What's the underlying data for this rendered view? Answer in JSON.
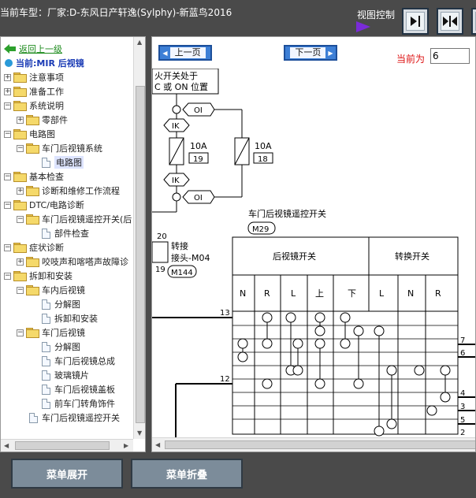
{
  "header": {
    "car_model": "当前车型：厂家:D-东风日产轩逸(Sylphy)-新蓝鸟2016",
    "view_control_label": "视图控制"
  },
  "tree": {
    "back_label": "返回上一级",
    "current_label": "当前:MIR 后视镜",
    "items": [
      {
        "label": "注意事项"
      },
      {
        "label": "准备工作"
      },
      {
        "label": "系统说明"
      },
      {
        "label": "零部件"
      },
      {
        "label": "电路图"
      },
      {
        "label": "车门后视镜系统"
      },
      {
        "label": "电路图"
      },
      {
        "label": "基本检查"
      },
      {
        "label": "诊断和维修工作流程"
      },
      {
        "label": "DTC/电路诊断"
      },
      {
        "label": "车门后视镜遥控开关(后"
      },
      {
        "label": "部件检查"
      },
      {
        "label": "症状诊断"
      },
      {
        "label": "咬吱声和喀嗒声故障诊"
      },
      {
        "label": "拆卸和安装"
      },
      {
        "label": "车内后视镜"
      },
      {
        "label": "分解图"
      },
      {
        "label": "拆卸和安装"
      },
      {
        "label": "车门后视镜"
      },
      {
        "label": "分解图"
      },
      {
        "label": "车门后视镜总成"
      },
      {
        "label": "玻璃镜片"
      },
      {
        "label": "车门后视镜盖板"
      },
      {
        "label": "前车门转角饰件"
      },
      {
        "label": "车门后视镜遥控开关"
      }
    ]
  },
  "pager": {
    "prev_label": "上一页",
    "next_label": "下一页",
    "current_page_label": "当前为",
    "current_page_value": "6"
  },
  "diagram": {
    "ign_line1": "火开关处于",
    "ign_line2": "C 或 ON 位置",
    "oi_label": "OI",
    "ik_label": "IK",
    "fuse_rating": "10A",
    "fuse_left_no": "19",
    "fuse_right_no": "18",
    "switch_title": "车门后视镜遥控开关",
    "switch_connector": "M29",
    "pin_20": "20",
    "pin_19": "19",
    "junction_line1": "转接",
    "junction_line2": "接头-M04",
    "junction_connector": "M144",
    "table_head_mirror": "后视镜开关",
    "table_head_change": "转换开关",
    "mirror_cols": [
      "N",
      "R",
      "L",
      "上",
      "下"
    ],
    "change_cols": [
      "L",
      "N",
      "R"
    ],
    "wire_13": "13",
    "wire_12": "12",
    "right_pins": [
      "7",
      "6",
      "4",
      "3",
      "5",
      "2"
    ]
  },
  "bottom": {
    "expand_label": "菜单展开",
    "collapse_label": "菜单折叠"
  }
}
